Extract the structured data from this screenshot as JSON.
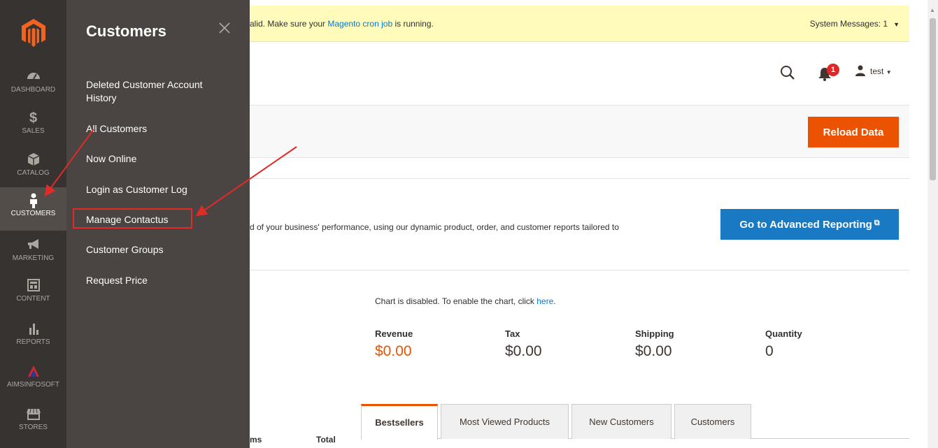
{
  "system_message": {
    "text_start": "alid. Make sure your ",
    "link": "Magento cron job",
    "text_end": " is running.",
    "count_label": "System Messages: 1"
  },
  "nav": {
    "items": [
      {
        "label": "DASHBOARD",
        "icon": "dashboard-icon"
      },
      {
        "label": "SALES",
        "icon": "dollar-icon"
      },
      {
        "label": "CATALOG",
        "icon": "box-icon"
      },
      {
        "label": "CUSTOMERS",
        "icon": "person-icon"
      },
      {
        "label": "MARKETING",
        "icon": "megaphone-icon"
      },
      {
        "label": "CONTENT",
        "icon": "layout-icon"
      },
      {
        "label": "REPORTS",
        "icon": "bar-chart-icon"
      },
      {
        "label": "AIMSINFOSOFT",
        "icon": "aimsinfosoft-logo-icon"
      },
      {
        "label": "STORES",
        "icon": "store-icon"
      }
    ],
    "active": "CUSTOMERS"
  },
  "flyout": {
    "title": "Customers",
    "items": [
      "Deleted Customer Account History",
      "All Customers",
      "Now Online",
      "Login as Customer Log",
      "Manage Contactus",
      "Customer Groups",
      "Request Price"
    ],
    "highlighted": "Manage Contactus"
  },
  "header": {
    "notification_count": "1",
    "user": "test"
  },
  "actions": {
    "reload": "Reload Data",
    "advanced_reporting": "Go to Advanced Reporting"
  },
  "advanced_text": "d of your business' performance, using our dynamic product, order, and customer reports tailored to",
  "chart_note": {
    "text": "Chart is disabled. To enable the chart, click ",
    "link": "here",
    "end": "."
  },
  "totals": [
    {
      "label": "Revenue",
      "value": "$0.00"
    },
    {
      "label": "Tax",
      "value": "$0.00"
    },
    {
      "label": "Shipping",
      "value": "$0.00"
    },
    {
      "label": "Quantity",
      "value": "0"
    }
  ],
  "tabs": [
    "Bestsellers",
    "Most Viewed Products",
    "New Customers",
    "Customers"
  ],
  "table_headers": [
    "ms",
    "Total"
  ],
  "colors": {
    "accent_orange": "#eb5202",
    "primary_blue": "#1979c3",
    "nav_bg": "#373330",
    "flyout_bg": "#4a4542",
    "highlight_red": "#e02b27"
  }
}
